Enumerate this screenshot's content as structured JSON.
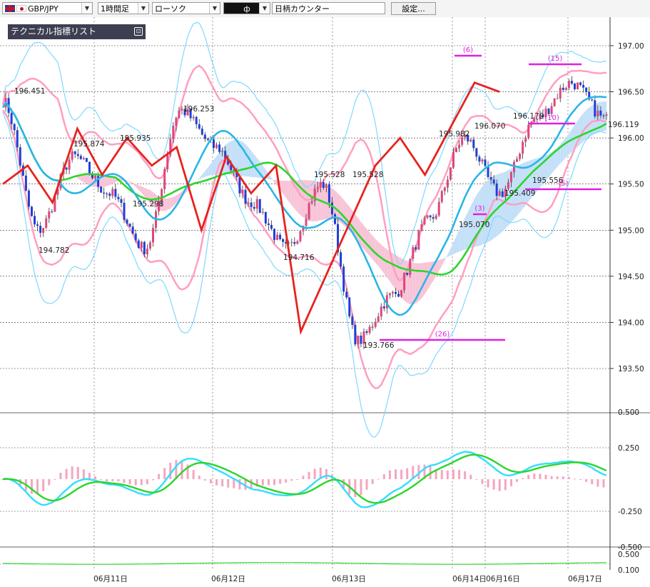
{
  "toolbar": {
    "symbol": "GBP/JPY",
    "timeframe": "1時間足",
    "chart_style": "ローソク",
    "drawing_tool": "ф",
    "counter": "日柄カウンター",
    "settings_label": "設定..."
  },
  "indicator_panel": {
    "label": "テクニカル指標リスト",
    "button": "⊡"
  },
  "colors": {
    "bull_candle": "#e0457b",
    "bear_candle": "#1f3fd8",
    "bollinger_outer": "#7fd8ff",
    "bollinger_inner": "#ff9ec2",
    "ma_short": "#29b6e6",
    "ma_long": "#2bd62b",
    "lagging_span": "#e8221e",
    "counter_line": "#e020e0",
    "cloud_bull": "#c4e0f8",
    "cloud_bear": "#f8c4d8"
  },
  "chart_data": [
    {
      "type": "candlestick",
      "y_ticks": [
        "197.00",
        "196.50",
        "196.00",
        "195.50",
        "195.00",
        "194.50",
        "194.00",
        "193.50"
      ],
      "ylim": [
        193.5,
        197.0
      ],
      "x_dates": [
        "06月11日",
        "06月12日",
        "06月13日",
        "06月14日",
        "06月16日",
        "06月17日"
      ],
      "price_labels": [
        {
          "text": "196.451",
          "value": 196.451
        },
        {
          "text": "195.874",
          "value": 195.874
        },
        {
          "text": "195.935",
          "value": 195.935
        },
        {
          "text": "195.298",
          "value": 195.298
        },
        {
          "text": "194.782",
          "value": 194.782
        },
        {
          "text": "196.253",
          "value": 196.253
        },
        {
          "text": "195.528",
          "value": 195.528
        },
        {
          "text": "195.528",
          "value": 195.528
        },
        {
          "text": "194.716",
          "value": 194.716
        },
        {
          "text": "193.766",
          "value": 193.766
        },
        {
          "text": "195.982",
          "value": 195.982
        },
        {
          "text": "196.070",
          "value": 196.07
        },
        {
          "text": "195.070",
          "value": 195.07
        },
        {
          "text": "196.179",
          "value": 196.179
        },
        {
          "text": "195.409",
          "value": 195.409
        },
        {
          "text": "195.556",
          "value": 195.556
        },
        {
          "text": "196.119",
          "value": 196.119
        }
      ],
      "counters": [
        "(26)",
        "(6)",
        "(3)",
        "(15)",
        "(10)",
        "(5)"
      ],
      "path_points": [
        196.4,
        195.0,
        195.8,
        195.4,
        194.8,
        196.3,
        195.9,
        195.3,
        194.8,
        195.5,
        193.8,
        194.3,
        195.1,
        196.0,
        195.4,
        196.2,
        196.6,
        196.2
      ],
      "lagging_points": [
        195.5,
        195.7,
        195.3,
        196.1,
        195.6,
        196.0,
        195.7,
        195.9,
        195.0,
        195.8,
        195.4,
        195.7,
        193.9,
        194.5,
        195.1,
        195.7,
        196.0,
        195.6,
        196.1,
        196.6,
        196.5
      ]
    },
    {
      "type": "bar",
      "name": "oscillator",
      "y_ticks": [
        "0.500",
        "0.250",
        "-0.250",
        "-0.500"
      ],
      "ylim": [
        -0.5,
        0.5
      ]
    },
    {
      "type": "line",
      "name": "sub_indicator",
      "y_ticks": [
        "0.500",
        "0.100"
      ]
    }
  ]
}
